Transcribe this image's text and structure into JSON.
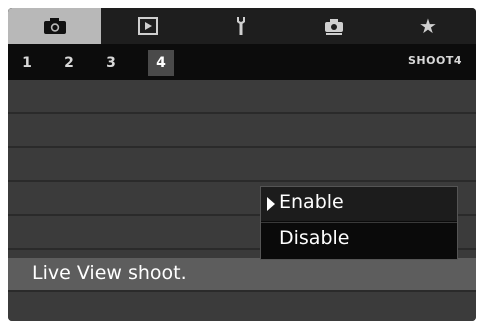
{
  "tabs": [
    {
      "icon": "camera-icon",
      "active": true
    },
    {
      "icon": "playback-icon",
      "active": false
    },
    {
      "icon": "wrench-icon",
      "active": false
    },
    {
      "icon": "custom-functions-icon",
      "active": false
    },
    {
      "icon": "star-icon",
      "active": false
    }
  ],
  "subtabs": [
    {
      "label": "1",
      "active": false
    },
    {
      "label": "2",
      "active": false
    },
    {
      "label": "3",
      "active": false
    },
    {
      "label": "4",
      "active": true
    }
  ],
  "subbar": {
    "label": "SHOOT4"
  },
  "menu": {
    "rows": [
      {
        "label": ""
      },
      {
        "label": ""
      },
      {
        "label": ""
      },
      {
        "label": ""
      },
      {
        "label": ""
      },
      {
        "label": "Live View shoot."
      },
      {
        "label": ""
      }
    ]
  },
  "options": {
    "items": [
      {
        "label": "Enable",
        "current": true
      },
      {
        "label": "Disable",
        "current": false
      }
    ]
  },
  "colors": {
    "active_tab": "#b8b8b8",
    "selected_row": "#5d5d5d",
    "background": "#3b3b3b"
  }
}
